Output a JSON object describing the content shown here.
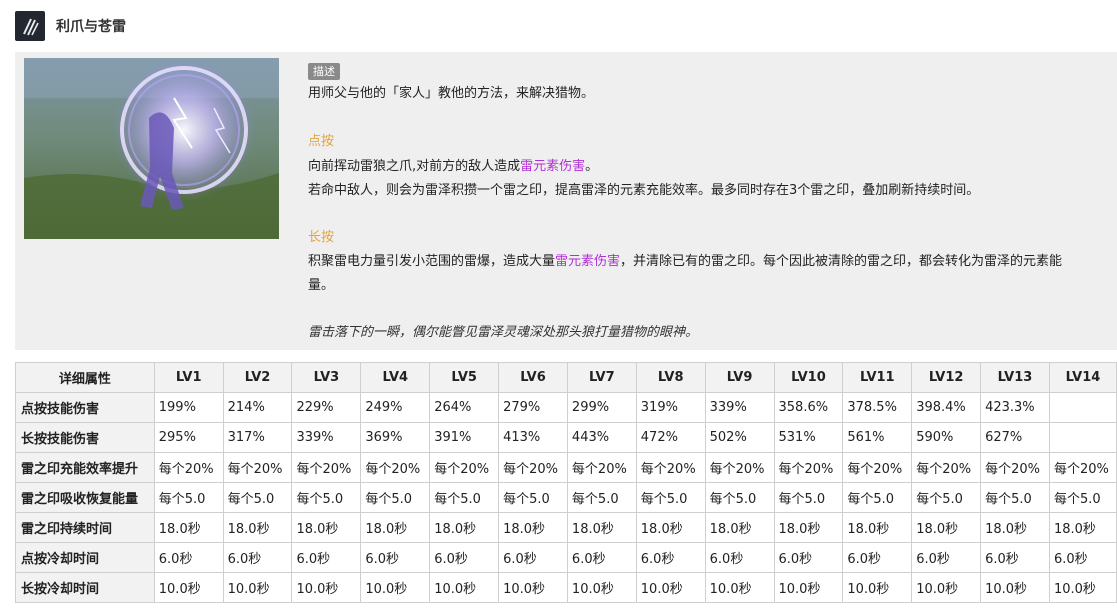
{
  "skill": {
    "title": "利爪与苍雷",
    "icon": "claw-slash-icon"
  },
  "description": {
    "tag": "描述",
    "intro": "用师父与他的「家人」教他的方法，来解决猎物。",
    "tap_heading": "点按",
    "tap_line1_a": "向前挥动雷狼之爪,对前方的敌人造成",
    "tap_line1_elec": "雷元素伤害",
    "tap_line1_b": "。",
    "tap_line2": "若命中敌人，则会为雷泽积攒一个雷之印，提高雷泽的元素充能效率。最多同时存在3个雷之印，叠加刷新持续时间。",
    "hold_heading": "长按",
    "hold_line1_a": "积聚雷电力量引发小范围的雷爆，造成大量",
    "hold_line1_elec": "雷元素伤害",
    "hold_line1_b": "，并清除已有的雷之印。每个因此被清除的雷之印，都会转化为雷泽的元素能",
    "hold_line2": "量。",
    "flavor": "雷击落下的一瞬，偶尔能瞥见雷泽灵魂深处那头狼打量猎物的眼神。"
  },
  "colors": {
    "section": "#e8a33d",
    "electro": "#b12fd6"
  },
  "table": {
    "headers": [
      "详细属性",
      "LV1",
      "LV2",
      "LV3",
      "LV4",
      "LV5",
      "LV6",
      "LV7",
      "LV8",
      "LV9",
      "LV10",
      "LV11",
      "LV12",
      "LV13",
      "LV14"
    ],
    "rows": [
      [
        "点按技能伤害",
        "199%",
        "214%",
        "229%",
        "249%",
        "264%",
        "279%",
        "299%",
        "319%",
        "339%",
        "358.6%",
        "378.5%",
        "398.4%",
        "423.3%",
        ""
      ],
      [
        "长按技能伤害",
        "295%",
        "317%",
        "339%",
        "369%",
        "391%",
        "413%",
        "443%",
        "472%",
        "502%",
        "531%",
        "561%",
        "590%",
        "627%",
        ""
      ],
      [
        "雷之印充能效率提升",
        "每个20%",
        "每个20%",
        "每个20%",
        "每个20%",
        "每个20%",
        "每个20%",
        "每个20%",
        "每个20%",
        "每个20%",
        "每个20%",
        "每个20%",
        "每个20%",
        "每个20%",
        "每个20%"
      ],
      [
        "雷之印吸收恢复能量",
        "每个5.0",
        "每个5.0",
        "每个5.0",
        "每个5.0",
        "每个5.0",
        "每个5.0",
        "每个5.0",
        "每个5.0",
        "每个5.0",
        "每个5.0",
        "每个5.0",
        "每个5.0",
        "每个5.0",
        "每个5.0"
      ],
      [
        "雷之印持续时间",
        "18.0秒",
        "18.0秒",
        "18.0秒",
        "18.0秒",
        "18.0秒",
        "18.0秒",
        "18.0秒",
        "18.0秒",
        "18.0秒",
        "18.0秒",
        "18.0秒",
        "18.0秒",
        "18.0秒",
        "18.0秒"
      ],
      [
        "点按冷却时间",
        "6.0秒",
        "6.0秒",
        "6.0秒",
        "6.0秒",
        "6.0秒",
        "6.0秒",
        "6.0秒",
        "6.0秒",
        "6.0秒",
        "6.0秒",
        "6.0秒",
        "6.0秒",
        "6.0秒",
        "6.0秒"
      ],
      [
        "长按冷却时间",
        "10.0秒",
        "10.0秒",
        "10.0秒",
        "10.0秒",
        "10.0秒",
        "10.0秒",
        "10.0秒",
        "10.0秒",
        "10.0秒",
        "10.0秒",
        "10.0秒",
        "10.0秒",
        "10.0秒",
        "10.0秒"
      ]
    ]
  }
}
